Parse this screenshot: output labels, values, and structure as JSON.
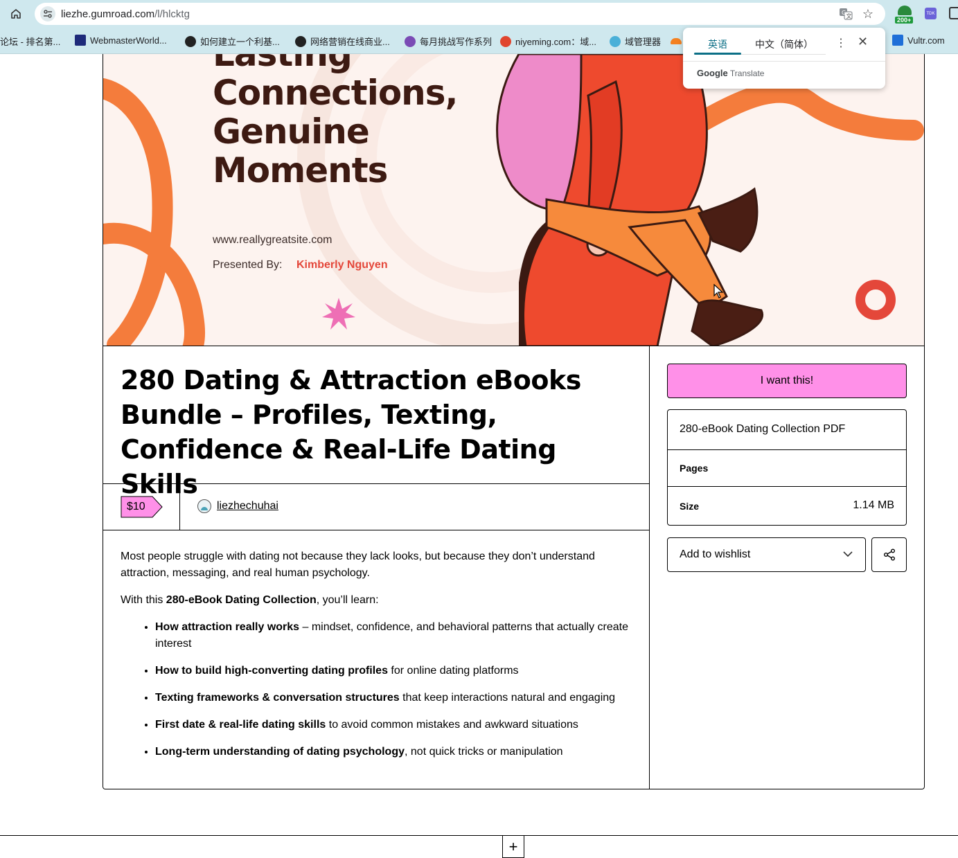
{
  "browser": {
    "url_host": "liezhe.gumroad.com",
    "url_path": "/l/hlcktg",
    "extension_badge": "200+",
    "extension2_label": "TDK"
  },
  "bookmarks": [
    {
      "label": "论坛 - 排名第...",
      "color": "#e8e8e8"
    },
    {
      "label": "WebmasterWorld...",
      "color": "#1e2a7a"
    },
    {
      "label": "如何建立一个利基...",
      "color": "#222222"
    },
    {
      "label": "网络营销在线商业...",
      "color": "#222222"
    },
    {
      "label": "每月挑战写作系列",
      "color": "#7a4bb5"
    },
    {
      "label": "niyeming.com：域...",
      "color": "#e0452e"
    },
    {
      "label": "域管理器",
      "color": "#4ab0d8"
    },
    {
      "label": "Vultr.com",
      "color": "#1e6fd8"
    }
  ],
  "translate_popup": {
    "tab_source": "英语",
    "tab_target": "中文（简体）",
    "brand_google": "Google",
    "brand_translate": "Translate"
  },
  "cover": {
    "headline_lines": [
      "Lasting",
      "Connections,",
      "Genuine",
      "Moments"
    ],
    "url": "www.reallygreatsite.com",
    "presented_by": "Presented By:",
    "presenter": "Kimberly Nguyen"
  },
  "product": {
    "title": "280 Dating & Attraction eBooks Bundle – Profiles, Texting, Confidence & Real-Life Dating Skills",
    "price": "$10",
    "seller": "liezhechuhai"
  },
  "description": {
    "intro": "Most people struggle with dating not because they lack looks, but because they don’t understand attraction, messaging, and real human psychology.",
    "learn_prefix": "With this ",
    "learn_bold": "280-eBook Dating Collection",
    "learn_suffix": ", you’ll learn:",
    "bullets": [
      {
        "bold": "How attraction really works",
        "rest": " – mindset, confidence, and behavioral patterns that actually create interest"
      },
      {
        "bold": "How to build high-converting dating profiles",
        "rest": " for online dating platforms"
      },
      {
        "bold": "Texting frameworks & conversation structures",
        "rest": " that keep interactions natural and engaging"
      },
      {
        "bold": "First date & real-life dating skills",
        "rest": " to avoid common mistakes and awkward situations"
      },
      {
        "bold": "Long-term understanding of dating psychology",
        "rest": ", not quick tricks or manipulation"
      }
    ]
  },
  "sidebar": {
    "buy_label": "I want this!",
    "info_title": "280-eBook Dating Collection PDF",
    "pages_label": "Pages",
    "pages_value": "",
    "size_label": "Size",
    "size_value": "1.14 MB",
    "wishlist_label": "Add to wishlist"
  },
  "colors": {
    "accent_pink": "#ff90e8",
    "cover_orange": "#f47c3c",
    "cover_red": "#e4473a",
    "cover_dark": "#3d1a12"
  }
}
